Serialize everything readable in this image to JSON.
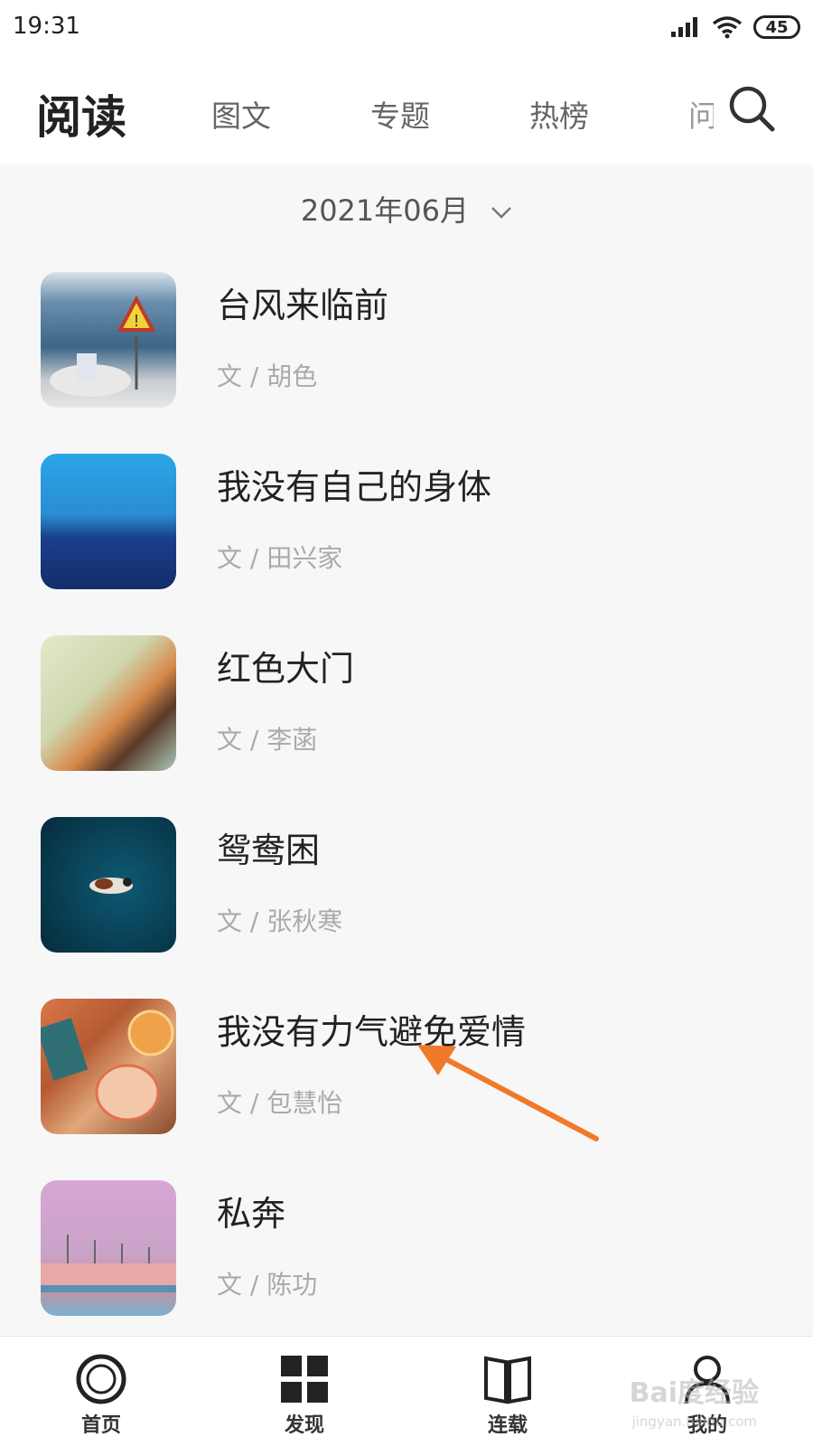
{
  "status_bar": {
    "time": "19:31",
    "battery": "45"
  },
  "nav": {
    "title": "阅读",
    "tabs": [
      "图文",
      "专题",
      "热榜",
      "问"
    ]
  },
  "month_picker": {
    "label": "2021年06月"
  },
  "articles": [
    {
      "title": "台风来临前",
      "author": "文 / 胡色"
    },
    {
      "title": "我没有自己的身体",
      "author": "文 / 田兴家"
    },
    {
      "title": "红色大门",
      "author": "文 / 李菡"
    },
    {
      "title": "鸳鸯困",
      "author": "文 / 张秋寒"
    },
    {
      "title": "我没有力气避免爱情",
      "author": "文 / 包慧怡"
    },
    {
      "title": "私奔",
      "author": "文 / 陈功"
    }
  ],
  "bottom_tabs": [
    {
      "label": "首页",
      "icon": "circle-icon"
    },
    {
      "label": "发现",
      "icon": "grid-icon"
    },
    {
      "label": "连载",
      "icon": "book-icon"
    },
    {
      "label": "我的",
      "icon": "user-icon"
    }
  ],
  "watermark": {
    "text": "Bai度经验",
    "sub": "jingyan.baidu.com"
  },
  "colors": {
    "annotation_arrow": "#f07a2a",
    "background": "#f7f7f7"
  }
}
